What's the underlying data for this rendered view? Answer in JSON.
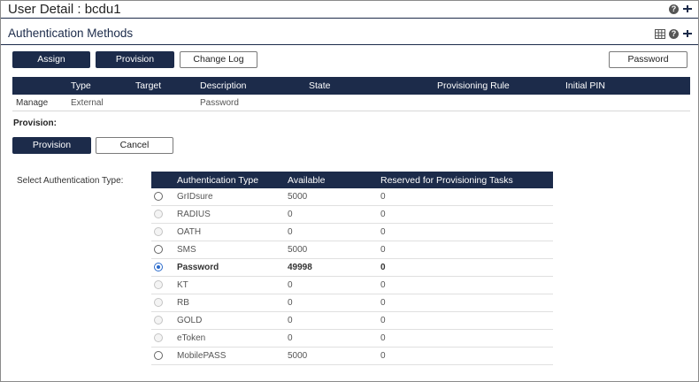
{
  "header": {
    "title": "User Detail : bcdu1"
  },
  "section": {
    "title": "Authentication Methods"
  },
  "toolbar": {
    "assign_label": "Assign",
    "provision_label": "Provision",
    "changelog_label": "Change Log",
    "password_label": "Password"
  },
  "methods_table": {
    "columns": [
      "Type",
      "Target",
      "Description",
      "State",
      "Provisioning Rule",
      "Initial PIN"
    ],
    "rows": [
      {
        "action": "Manage",
        "type": "External",
        "target": "",
        "description": "Password",
        "state": "",
        "rule": "",
        "pin": ""
      }
    ]
  },
  "provision": {
    "label": "Provision:",
    "provision_button": "Provision",
    "cancel_button": "Cancel",
    "select_label": "Select Authentication Type:"
  },
  "auth_types": {
    "columns": [
      "Authentication Type",
      "Available",
      "Reserved for Provisioning Tasks"
    ],
    "rows": [
      {
        "name": "GrIDsure",
        "available": "5000",
        "reserved": "0",
        "enabled": true,
        "selected": false
      },
      {
        "name": "RADIUS",
        "available": "0",
        "reserved": "0",
        "enabled": false,
        "selected": false
      },
      {
        "name": "OATH",
        "available": "0",
        "reserved": "0",
        "enabled": false,
        "selected": false
      },
      {
        "name": "SMS",
        "available": "5000",
        "reserved": "0",
        "enabled": true,
        "selected": false
      },
      {
        "name": "Password",
        "available": "49998",
        "reserved": "0",
        "enabled": true,
        "selected": true
      },
      {
        "name": "KT",
        "available": "0",
        "reserved": "0",
        "enabled": false,
        "selected": false
      },
      {
        "name": "RB",
        "available": "0",
        "reserved": "0",
        "enabled": false,
        "selected": false
      },
      {
        "name": "GOLD",
        "available": "0",
        "reserved": "0",
        "enabled": false,
        "selected": false
      },
      {
        "name": "eToken",
        "available": "0",
        "reserved": "0",
        "enabled": false,
        "selected": false
      },
      {
        "name": "MobilePASS",
        "available": "5000",
        "reserved": "0",
        "enabled": true,
        "selected": false
      }
    ]
  },
  "icons": {
    "help": "help-icon",
    "pin": "pin-icon",
    "grid": "grid-icon"
  },
  "colors": {
    "navy": "#1c2b4a",
    "radio_selected": "#2a6acb"
  }
}
